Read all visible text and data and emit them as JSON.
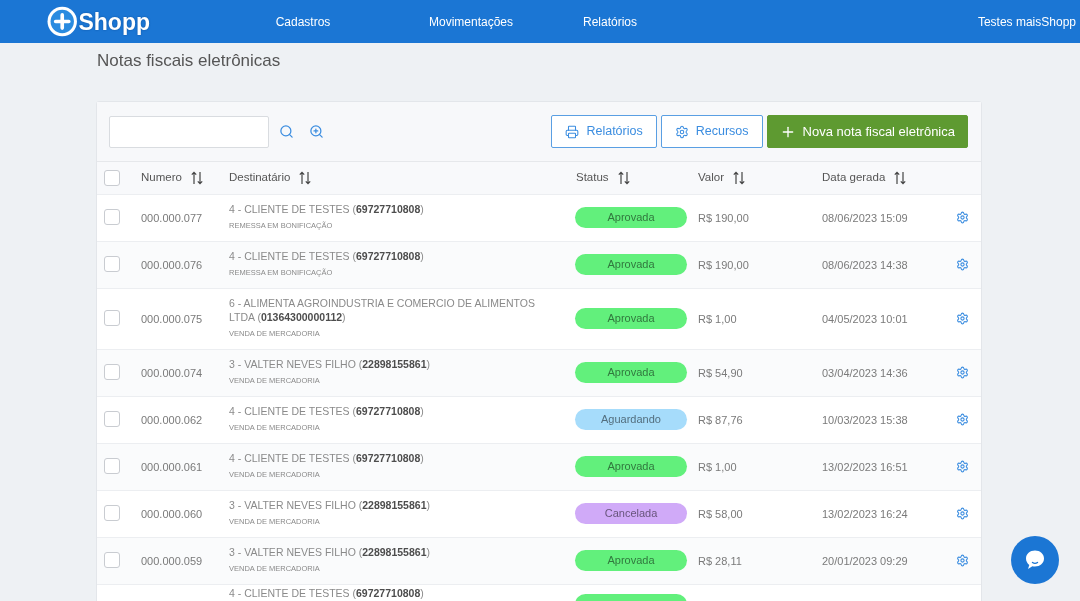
{
  "header": {
    "logo": "Shopp",
    "nav": [
      {
        "label": "Cadastros"
      },
      {
        "label": "Movimentações"
      },
      {
        "label": "Relatórios"
      }
    ],
    "user": "Testes maisShopp"
  },
  "page_title": "Notas fiscais eletrônicas",
  "toolbar": {
    "buttons": [
      {
        "label": "Relatórios",
        "kind": "outline"
      },
      {
        "label": "Recursos",
        "kind": "outline"
      },
      {
        "label": "Nova nota fiscal eletrônica",
        "kind": "primary"
      }
    ]
  },
  "table": {
    "select_all": {
      "checked": false
    },
    "columns": [
      "Numero",
      "Destinatário",
      "Status",
      "Valor",
      "Data gerada"
    ],
    "rows": [
      {
        "checked": false,
        "numero": "000.000.077",
        "destinatario": "4 - CLIENTE DE TESTES (**69727710808**)",
        "subtitle": "REMESSA EM BONIFICAÇÃO",
        "status": {
          "label": "Aprovada",
          "color": "#62f07c"
        },
        "valor": "R$ 190,00",
        "data": "08/06/2023 15:09"
      },
      {
        "checked": false,
        "numero": "000.000.076",
        "destinatario": "4 - CLIENTE DE TESTES (**69727710808**)",
        "subtitle": "REMESSA EM BONIFICAÇÃO",
        "status": {
          "label": "Aprovada",
          "color": "#62f07c"
        },
        "valor": "R$ 190,00",
        "data": "08/06/2023 14:38"
      },
      {
        "checked": false,
        "numero": "000.000.075",
        "destinatario": "6 - ALIMENTA AGROINDUSTRIA E COMERCIO DE ALIMENTOS LTDA (**01364300000112**)",
        "subtitle": "VENDA DE MERCADORIA",
        "status": {
          "label": "Aprovada",
          "color": "#62f07c"
        },
        "valor": "R$ 1,00",
        "data": "04/05/2023 10:01"
      },
      {
        "checked": false,
        "numero": "000.000.074",
        "destinatario": "3 - VALTER NEVES FILHO (**22898155861**)",
        "subtitle": "VENDA DE MERCADORIA",
        "status": {
          "label": "Aprovada",
          "color": "#62f07c"
        },
        "valor": "R$ 54,90",
        "data": "03/04/2023 14:36"
      },
      {
        "checked": false,
        "numero": "000.000.062",
        "destinatario": "4 - CLIENTE DE TESTES (**69727710808**)",
        "subtitle": "VENDA DE MERCADORIA",
        "status": {
          "label": "Aguardando",
          "color": "#a6dcfb"
        },
        "valor": "R$ 87,76",
        "data": "10/03/2023 15:38"
      },
      {
        "checked": false,
        "numero": "000.000.061",
        "destinatario": "4 - CLIENTE DE TESTES (**69727710808**)",
        "subtitle": "VENDA DE MERCADORIA",
        "status": {
          "label": "Aprovada",
          "color": "#62f07c"
        },
        "valor": "R$ 1,00",
        "data": "13/02/2023 16:51"
      },
      {
        "checked": false,
        "numero": "000.000.060",
        "destinatario": "3 - VALTER NEVES FILHO (**22898155861**)",
        "subtitle": "VENDA DE MERCADORIA",
        "status": {
          "label": "Cancelada",
          "color": "#d0aaf8"
        },
        "valor": "R$ 58,00",
        "data": "13/02/2023 16:24"
      },
      {
        "checked": false,
        "numero": "000.000.059",
        "destinatario": "3 - VALTER NEVES FILHO (**22898155861**)",
        "subtitle": "VENDA DE MERCADORIA",
        "status": {
          "label": "Aprovada",
          "color": "#62f07c"
        },
        "valor": "R$ 28,11",
        "data": "20/01/2023 09:29"
      },
      {
        "destinatario": "4 - CLIENTE DE TESTES (**69727710808**)",
        "status": {
          "color": "#62f07c"
        }
      }
    ]
  }
}
